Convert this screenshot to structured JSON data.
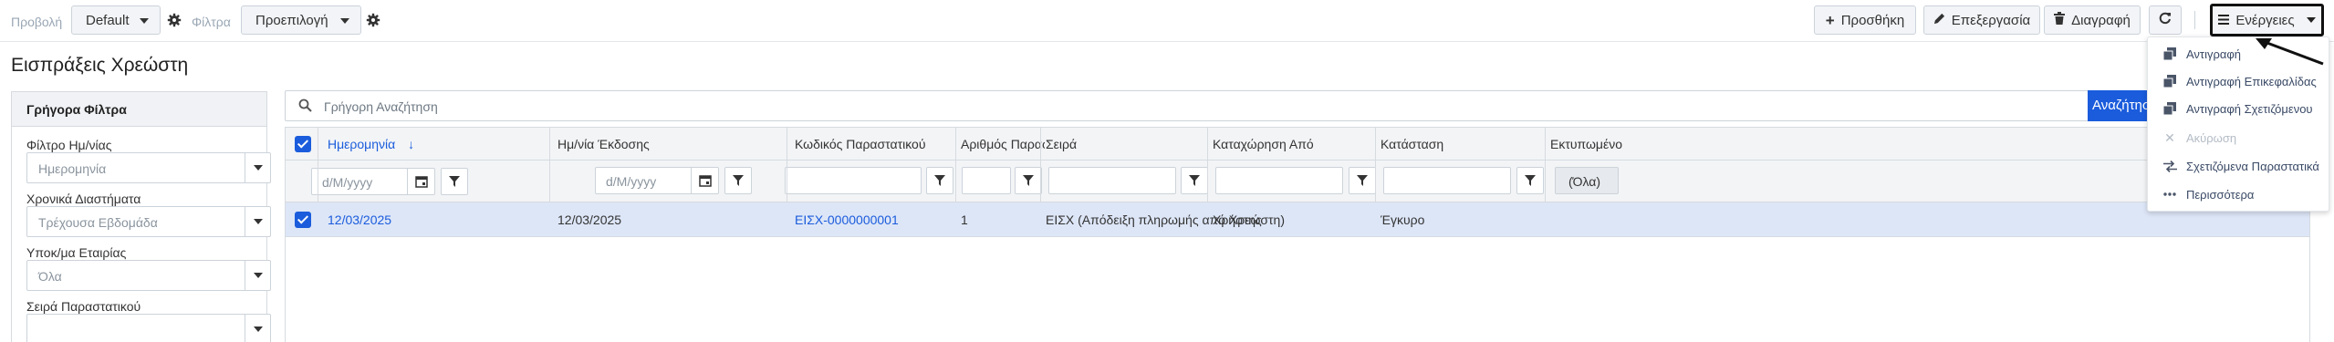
{
  "toolbar": {
    "view_label": "Προβολή",
    "view_value": "Default",
    "filters_label": "Φίλτρα",
    "filters_value": "Προεπιλογή",
    "add_label": "Προσθήκη",
    "edit_label": "Επεξεργασία",
    "delete_label": "Διαγραφή",
    "actions_label": "Ενέργειες"
  },
  "page": {
    "title": "Εισπράξεις Χρεώστη"
  },
  "quick_filters": {
    "title": "Γρήγορα Φίλτρα",
    "fields": [
      {
        "label": "Φίλτρο Ημ/νίας",
        "value": "Ημερομηνία"
      },
      {
        "label": "Χρονικά Διαστήματα",
        "value": "Τρέχουσα Εβδομάδα"
      },
      {
        "label": "Υποκ/μα Εταιρίας",
        "value": "Όλα"
      },
      {
        "label": "Σειρά Παραστατικού",
        "value": ""
      }
    ]
  },
  "search": {
    "placeholder": "Γρήγορη Αναζήτηση",
    "button": "Αναζήτηση"
  },
  "grid": {
    "columns": [
      "Ημερομηνία",
      "Ημ/νία Έκδοσης",
      "Κωδικός Παραστατικού",
      "Αριθμός Παραστατ...",
      "Σειρά",
      "Καταχώρηση Από",
      "Κατάσταση",
      "Εκτυπωμένο"
    ],
    "sort_indicator": "↓",
    "date_placeholder": "d/M/yyyy",
    "printed_filter": "(Όλα)",
    "rows": [
      {
        "date": "12/03/2025",
        "issue_date": "12/03/2025",
        "code": "ΕΙΣΧ-0000000001",
        "number": "1",
        "series": "ΕΙΣΧ (Απόδειξη πληρωμής από Χρεώστη)",
        "entered_by": "Χρήστης",
        "status": "Έγκυρο"
      }
    ]
  },
  "actions_menu": {
    "items": [
      {
        "label": "Αντιγραφή",
        "icon": "copy-icon",
        "disabled": false
      },
      {
        "label": "Αντιγραφή Επικεφαλίδας",
        "icon": "copy-icon",
        "disabled": false
      },
      {
        "label": "Αντιγραφή Σχετιζόμενου",
        "icon": "copy-icon",
        "disabled": false
      },
      {
        "label": "Ακύρωση",
        "icon": "close-icon",
        "disabled": true
      },
      {
        "label": "Σχετιζόμενα Παραστατικά",
        "icon": "swap-arrows-icon",
        "disabled": false
      },
      {
        "label": "Περισσότερα",
        "icon": "more-dots-icon",
        "disabled": false
      }
    ]
  },
  "colors": {
    "accent": "#1a5cdc",
    "selected_row": "#dde6f7",
    "header_bg": "#f3f4f6"
  }
}
